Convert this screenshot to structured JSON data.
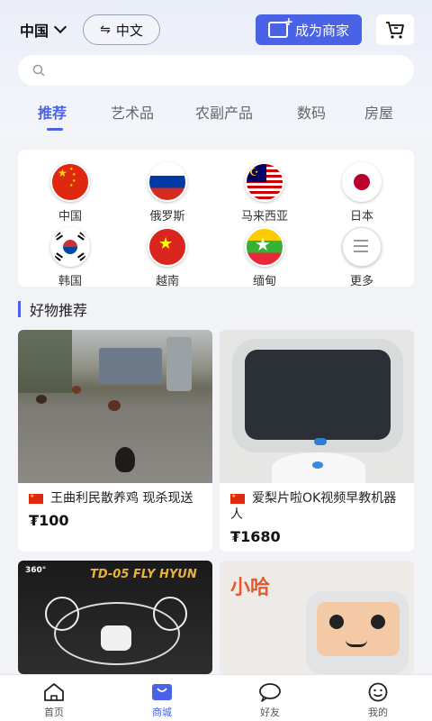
{
  "header": {
    "country_label": "中国",
    "language_label": "中文",
    "merchant_button": "成为商家",
    "search_placeholder": ""
  },
  "tabs": [
    {
      "label": "推荐",
      "active": true
    },
    {
      "label": "艺术品",
      "active": false
    },
    {
      "label": "农副产品",
      "active": false
    },
    {
      "label": "数码",
      "active": false
    },
    {
      "label": "房屋",
      "active": false
    }
  ],
  "countries": [
    {
      "name": "中国",
      "flag_icon": "china-flag-icon"
    },
    {
      "name": "俄罗斯",
      "flag_icon": "russia-flag-icon"
    },
    {
      "name": "马来西亚",
      "flag_icon": "malaysia-flag-icon"
    },
    {
      "name": "日本",
      "flag_icon": "japan-flag-icon"
    },
    {
      "name": "韩国",
      "flag_icon": "korea-flag-icon"
    },
    {
      "name": "越南",
      "flag_icon": "vietnam-flag-icon"
    },
    {
      "name": "缅甸",
      "flag_icon": "myanmar-flag-icon"
    },
    {
      "name": "更多",
      "flag_icon": "more-icon"
    }
  ],
  "section_title": "好物推荐",
  "products": [
    {
      "title": "王曲利民散养鸡 现杀现送",
      "price": "₮100",
      "image": "free-range-chicken-photo"
    },
    {
      "title": "爱梨片啦OK视频早教机器人",
      "price": "₮1680",
      "image": "education-robot-photo"
    },
    {
      "title": "",
      "price": "",
      "image": "drone-box-photo",
      "image_text": "TD-05 FLY HYUN",
      "image_badge": "360°"
    },
    {
      "title": "",
      "price": "",
      "image": "kids-robot-box-photo",
      "image_text": "小哈"
    }
  ],
  "nav": [
    {
      "label": "首页",
      "icon": "home-icon",
      "active": false
    },
    {
      "label": "商城",
      "icon": "shop-icon",
      "active": true
    },
    {
      "label": "好友",
      "icon": "chat-icon",
      "active": false
    },
    {
      "label": "我的",
      "icon": "profile-icon",
      "active": false
    }
  ],
  "colors": {
    "accent": "#4a63e6",
    "background": "#f2f3f7"
  }
}
